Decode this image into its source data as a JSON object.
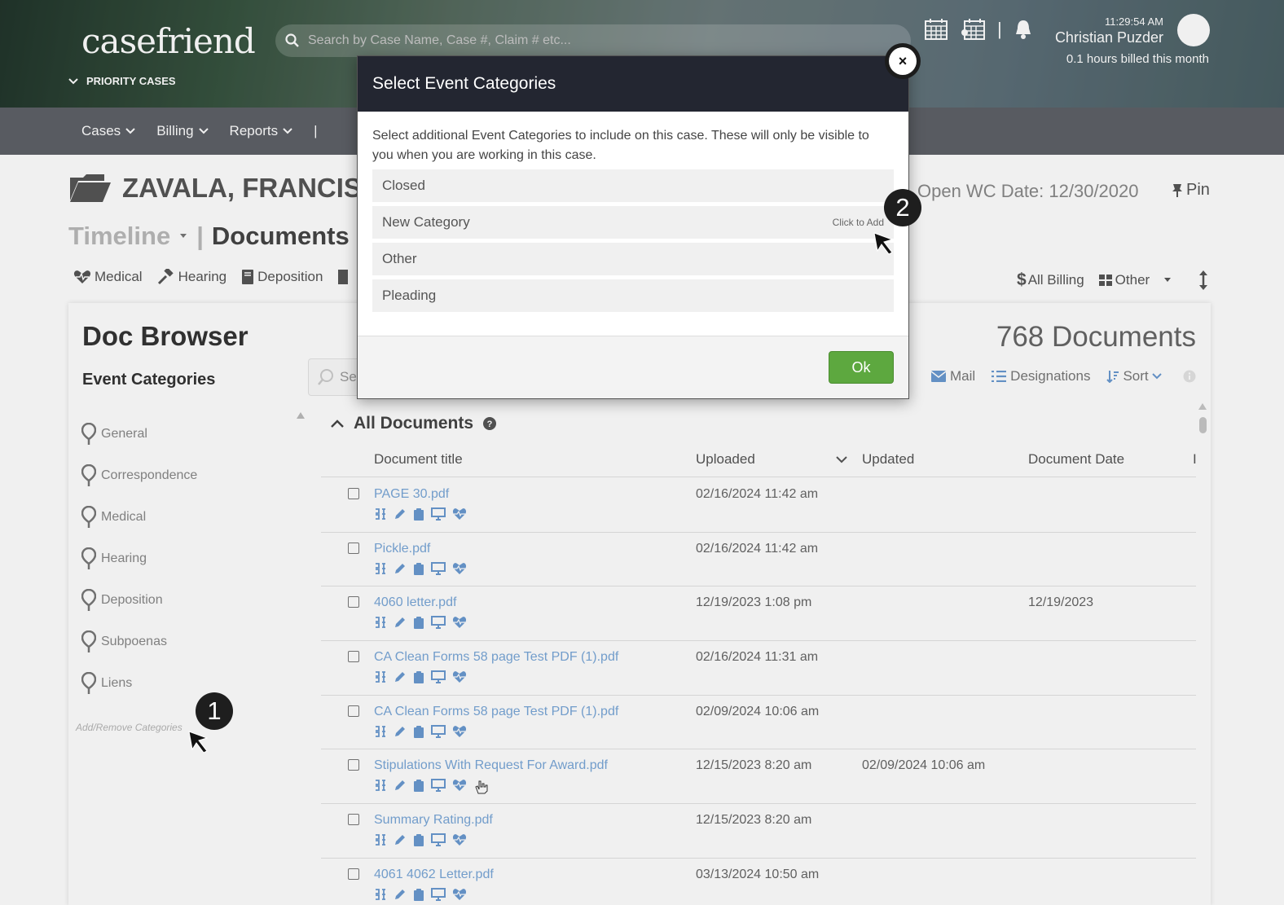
{
  "header": {
    "logo": "casefriend",
    "priority_cases": "PRIORITY CASES",
    "search_placeholder": "Search by Case Name, Case #, Claim # etc...",
    "clock": "11:29:54 AM",
    "user_name": "Christian Puzder",
    "billed": "0.1 hours billed this month"
  },
  "nav": {
    "items": [
      {
        "label": "Cases"
      },
      {
        "label": "Billing"
      },
      {
        "label": "Reports"
      }
    ],
    "divider": "|"
  },
  "case": {
    "name": "ZAVALA, FRANCIS",
    "open_wc_date": "Open WC Date:  12/30/2020",
    "pin": "Pin"
  },
  "views": {
    "timeline": "Timeline",
    "divider": "|",
    "documents": "Documents"
  },
  "filters": {
    "left": [
      "Medical",
      "Hearing",
      "Deposition"
    ],
    "all_billing": "All Billing",
    "other": "Other"
  },
  "doc_browser": {
    "title": "Doc Browser",
    "event_categories_title": "Event Categories",
    "categories": [
      "General",
      "Correspondence",
      "Medical",
      "Hearing",
      "Deposition",
      "Subpoenas",
      "Liens"
    ],
    "add_remove": "Add/Remove Categories",
    "doc_count": "768 Documents",
    "search_placeholder": "Se",
    "toolbar": {
      "mail": "Mail",
      "designations": "Designations",
      "sort": "Sort"
    },
    "all_documents": "All Documents",
    "columns": {
      "title": "Document title",
      "uploaded": "Uploaded",
      "updated": "Updated",
      "document_date": "Document Date",
      "more": "I"
    },
    "rows": [
      {
        "title": "PAGE 30.pdf",
        "uploaded": "02/16/2024 11:42 am",
        "updated": "",
        "document_date": ""
      },
      {
        "title": "Pickle.pdf",
        "uploaded": "02/16/2024 11:42 am",
        "updated": "",
        "document_date": ""
      },
      {
        "title": "4060 letter.pdf",
        "uploaded": "12/19/2023 1:08 pm",
        "updated": "",
        "document_date": "12/19/2023"
      },
      {
        "title": "CA Clean Forms 58 page Test PDF (1).pdf",
        "uploaded": "02/16/2024 11:31 am",
        "updated": "",
        "document_date": ""
      },
      {
        "title": "CA Clean Forms 58 page Test PDF (1).pdf",
        "uploaded": "02/09/2024 10:06 am",
        "updated": "",
        "document_date": ""
      },
      {
        "title": "Stipulations With Request For Award.pdf",
        "uploaded": "12/15/2023 8:20 am",
        "updated": "02/09/2024 10:06 am",
        "document_date": ""
      },
      {
        "title": "Summary Rating.pdf",
        "uploaded": "12/15/2023 8:20 am",
        "updated": "",
        "document_date": ""
      },
      {
        "title": "4061 4062 Letter.pdf",
        "uploaded": "03/13/2024 10:50 am",
        "updated": "",
        "document_date": ""
      }
    ]
  },
  "modal": {
    "title": "Select Event Categories",
    "description": "Select additional Event Categories to include on this case. These will only be visible to you when you are working in this case.",
    "options": [
      {
        "label": "Closed",
        "hint": ""
      },
      {
        "label": "New Category",
        "hint": "Click to Add"
      },
      {
        "label": "Other",
        "hint": ""
      },
      {
        "label": "Pleading",
        "hint": ""
      }
    ],
    "ok": "Ok",
    "close": "×"
  },
  "markers": {
    "one": "1",
    "two": "2"
  },
  "colors": {
    "link": "#7aa7d8",
    "ok_green": "#5da83f",
    "modal_header": "#232631",
    "nav": "#5e6168"
  },
  "icons": [
    "search-icon",
    "chevron-down-icon",
    "calendar-icon",
    "bell-icon",
    "folder-icon",
    "heart-icon",
    "gavel-icon",
    "book-icon",
    "dollar-icon",
    "grid-icon",
    "sort-icon",
    "mail-icon",
    "list-icon",
    "pin-icon",
    "map-marker-icon",
    "checkbox"
  ]
}
